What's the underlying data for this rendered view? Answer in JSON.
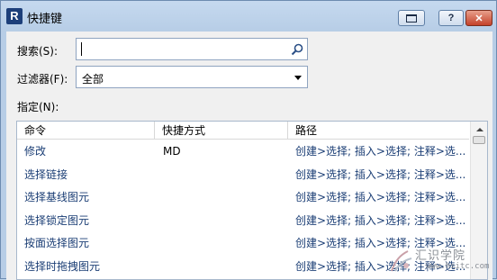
{
  "window": {
    "app_icon_letter": "R",
    "title": "快捷键",
    "help_label": "?",
    "close_label": "✕"
  },
  "search": {
    "label": "搜索(S):",
    "value": "",
    "placeholder": ""
  },
  "filter": {
    "label": "过滤器(F):",
    "selected": "全部"
  },
  "assigned_label": "指定(N):",
  "table": {
    "headers": [
      "命令",
      "快捷方式",
      "路径"
    ],
    "rows": [
      {
        "command": "修改",
        "shortcut": "MD",
        "path": "创建>选择; 插入>选择; 注释>选..."
      },
      {
        "command": "选择链接",
        "shortcut": "",
        "path": "创建>选择; 插入>选择; 注释>选..."
      },
      {
        "command": "选择基线图元",
        "shortcut": "",
        "path": "创建>选择; 插入>选择; 注释>选..."
      },
      {
        "command": "选择锁定图元",
        "shortcut": "",
        "path": "创建>选择; 插入>选择; 注释>选..."
      },
      {
        "command": "按面选择图元",
        "shortcut": "",
        "path": "创建>选择; 插入>选择; 注释>选..."
      },
      {
        "command": "选择时拖拽图元",
        "shortcut": "",
        "path": "创建>选择; 插入>选择; 注释>选..."
      }
    ]
  },
  "watermark": {
    "title": "汇识学院",
    "subtitle": "www.hsitc.com"
  },
  "colors": {
    "title_bar": "#c5d9ef",
    "close_button": "#c4412a",
    "link_text": "#1b3e75"
  }
}
